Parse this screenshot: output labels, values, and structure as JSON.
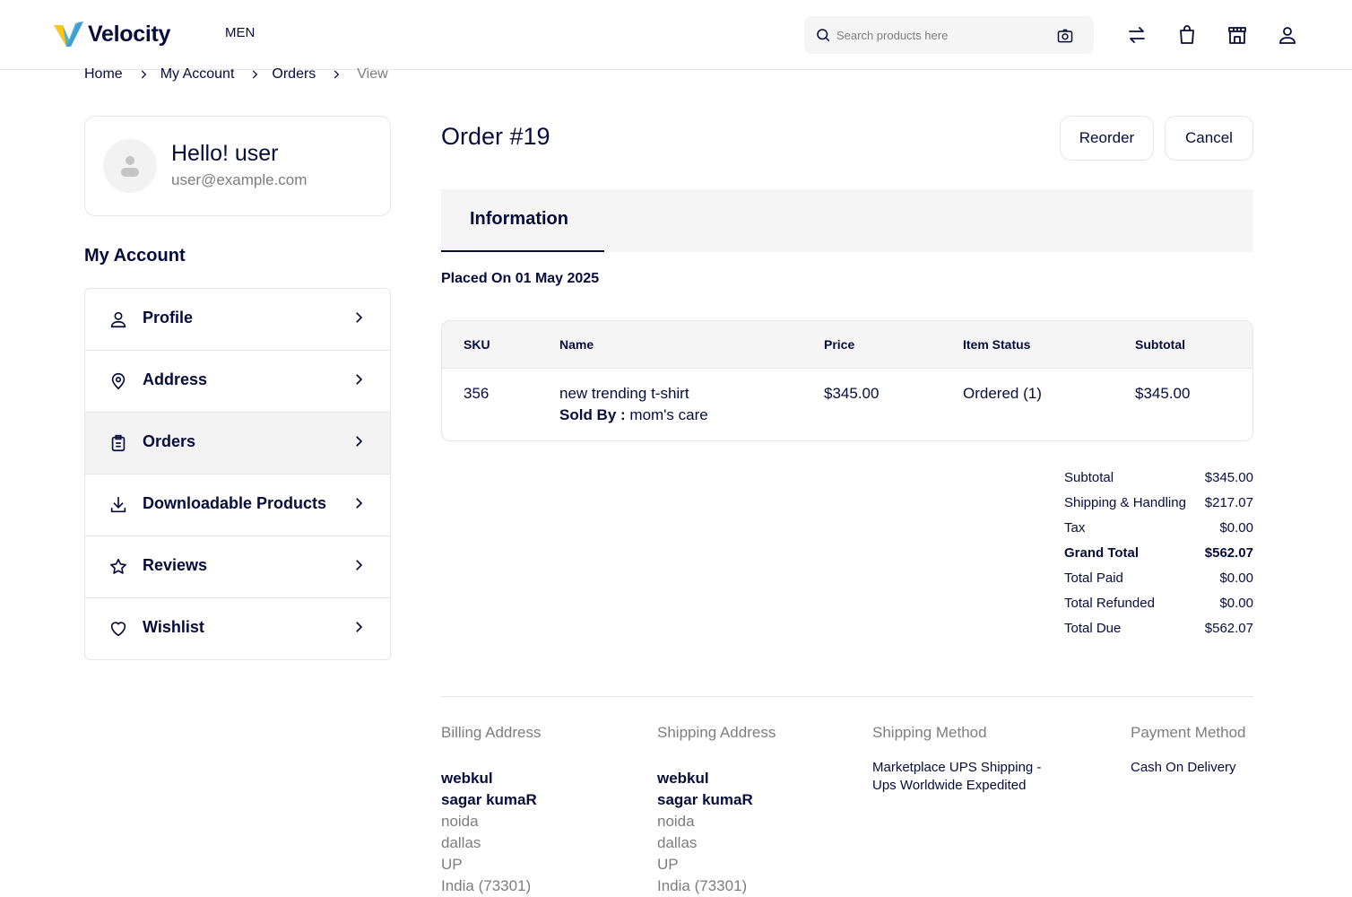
{
  "header": {
    "brand": "Velocity",
    "nav_item": "MEN",
    "search_placeholder": "Search products here",
    "colors": {
      "brand_navy": "#060c3b",
      "logo_yellow": "#FFC51A",
      "logo_blue": "#3CB0E5"
    }
  },
  "breadcrumb": {
    "items": [
      "Home",
      "My Account",
      "Orders"
    ],
    "current": "View"
  },
  "user": {
    "greeting": "Hello! user",
    "email": "user@example.com"
  },
  "sidebar": {
    "title": "My Account",
    "items": [
      {
        "label": "Profile",
        "icon": "user-icon",
        "active": false
      },
      {
        "label": "Address",
        "icon": "map-pin-icon",
        "active": false
      },
      {
        "label": "Orders",
        "icon": "clipboard-icon",
        "active": true
      },
      {
        "label": "Downloadable Products",
        "icon": "download-icon",
        "active": false
      },
      {
        "label": "Reviews",
        "icon": "star-icon",
        "active": false
      },
      {
        "label": "Wishlist",
        "icon": "heart-icon",
        "active": false
      }
    ]
  },
  "order": {
    "title": "Order #19",
    "reorder_label": "Reorder",
    "cancel_label": "Cancel",
    "tab_label": "Information",
    "placed_on": "Placed On 01 May 2025"
  },
  "items_table": {
    "headers": [
      "SKU",
      "Name",
      "Price",
      "Item Status",
      "Subtotal"
    ],
    "rows": [
      {
        "sku": "356",
        "name": "new trending t-shirt",
        "sold_by_label": "Sold By :",
        "sold_by": "mom's care",
        "price": "$345.00",
        "status": "Ordered (1)",
        "subtotal": "$345.00"
      }
    ]
  },
  "totals": [
    {
      "label": "Subtotal",
      "value": "$345.00",
      "bold": false
    },
    {
      "label": "Shipping & Handling",
      "value": "$217.07",
      "bold": false
    },
    {
      "label": "Tax",
      "value": "$0.00",
      "bold": false
    },
    {
      "label": "Grand Total",
      "value": "$562.07",
      "bold": true
    },
    {
      "label": "Total Paid",
      "value": "$0.00",
      "bold": false
    },
    {
      "label": "Total Refunded",
      "value": "$0.00",
      "bold": false
    },
    {
      "label": "Total Due",
      "value": "$562.07",
      "bold": false
    }
  ],
  "billing": {
    "heading": "Billing Address",
    "company": "webkul",
    "name": "sagar kumaR",
    "lines": [
      "noida",
      "dallas",
      "UP",
      "India (73301)"
    ]
  },
  "shipping": {
    "heading": "Shipping Address",
    "company": "webkul",
    "name": "sagar kumaR",
    "lines": [
      "noida",
      "dallas",
      "UP",
      "India (73301)"
    ]
  },
  "shipping_method": {
    "heading": "Shipping Method",
    "line1": "Marketplace UPS Shipping -",
    "line2": "Ups Worldwide Expedited"
  },
  "payment_method": {
    "heading": "Payment Method",
    "value": "Cash On Delivery"
  }
}
